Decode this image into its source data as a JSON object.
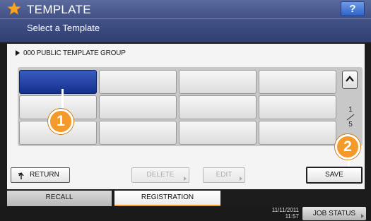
{
  "header": {
    "title": "TEMPLATE",
    "subtitle": "Select a Template",
    "help_label": "?",
    "star_icon": "star-icon"
  },
  "group": {
    "label": "000 PUBLIC TEMPLATE GROUP"
  },
  "grid": {
    "rows": 3,
    "cols": 4,
    "selected_index": 0
  },
  "pagination": {
    "current": "1",
    "total": "5"
  },
  "callouts": {
    "first": "1",
    "second": "2"
  },
  "buttons": {
    "return_label": "RETURN",
    "delete_label": "DELETE",
    "edit_label": "EDIT",
    "save_label": "SAVE"
  },
  "tabs": {
    "recall": "RECALL",
    "registration": "REGISTRATION"
  },
  "status": {
    "date": "11/11/2011",
    "time": "11:57",
    "job_status_label": "JOB STATUS"
  },
  "colors": {
    "header_top": "#5b6b9e",
    "header_bottom": "#2f3f74",
    "selected_tile": "#1e3a9a",
    "callout": "#f39a2a",
    "help": "#2e62c8"
  }
}
